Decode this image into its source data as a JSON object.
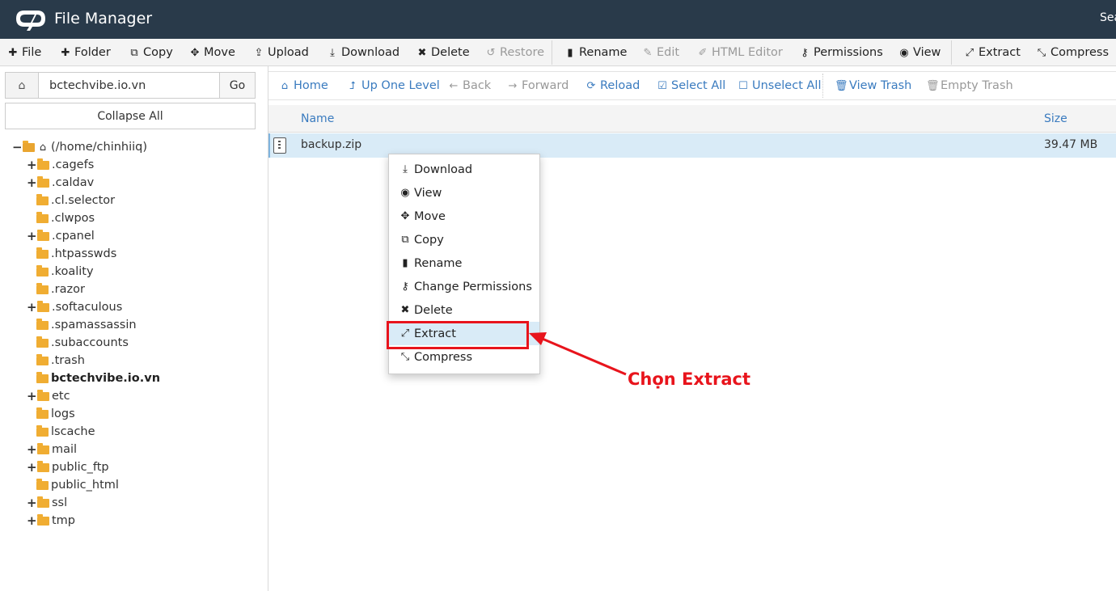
{
  "header": {
    "title": "File Manager",
    "search_partial": "Sea"
  },
  "toolbar": {
    "file": "File",
    "folder": "Folder",
    "copy": "Copy",
    "move": "Move",
    "upload": "Upload",
    "download": "Download",
    "delete": "Delete",
    "restore": "Restore",
    "rename": "Rename",
    "edit": "Edit",
    "html_editor": "HTML Editor",
    "permissions": "Permissions",
    "view": "View",
    "extract": "Extract",
    "compress": "Compress"
  },
  "sidebar": {
    "path_value": "bctechvibe.io.vn",
    "go_label": "Go",
    "collapse_label": "Collapse All",
    "root_label": "(/home/chinhiiq)",
    "items": [
      {
        "label": ".cagefs",
        "expandable": true
      },
      {
        "label": ".caldav",
        "expandable": true
      },
      {
        "label": ".cl.selector",
        "expandable": false
      },
      {
        "label": ".clwpos",
        "expandable": false
      },
      {
        "label": ".cpanel",
        "expandable": true
      },
      {
        "label": ".htpasswds",
        "expandable": false
      },
      {
        "label": ".koality",
        "expandable": false
      },
      {
        "label": ".razor",
        "expandable": false
      },
      {
        "label": ".softaculous",
        "expandable": true
      },
      {
        "label": ".spamassassin",
        "expandable": false
      },
      {
        "label": ".subaccounts",
        "expandable": false
      },
      {
        "label": ".trash",
        "expandable": false
      },
      {
        "label": "bctechvibe.io.vn",
        "expandable": false,
        "current": true
      },
      {
        "label": "etc",
        "expandable": true
      },
      {
        "label": "logs",
        "expandable": false
      },
      {
        "label": "lscache",
        "expandable": false
      },
      {
        "label": "mail",
        "expandable": true
      },
      {
        "label": "public_ftp",
        "expandable": true
      },
      {
        "label": "public_html",
        "expandable": false
      },
      {
        "label": "ssl",
        "expandable": true
      },
      {
        "label": "tmp",
        "expandable": true
      }
    ]
  },
  "navbar": {
    "home": "Home",
    "up_one_level": "Up One Level",
    "back": "Back",
    "forward": "Forward",
    "reload": "Reload",
    "select_all": "Select All",
    "unselect_all": "Unselect All",
    "view_trash": "View Trash",
    "empty_trash": "Empty Trash"
  },
  "table": {
    "col_name": "Name",
    "col_size": "Size",
    "rows": [
      {
        "name": "backup.zip",
        "size": "39.47 MB"
      }
    ]
  },
  "context_menu": {
    "download": "Download",
    "view": "View",
    "move": "Move",
    "copy": "Copy",
    "rename": "Rename",
    "change_permissions": "Change Permissions",
    "delete": "Delete",
    "extract": "Extract",
    "compress": "Compress"
  },
  "annotation": {
    "label": "Chọn Extract",
    "color": "#e8141c"
  },
  "colors": {
    "header_bg": "#293a4a",
    "link_blue": "#3a7bbf",
    "folder": "#f0ad32",
    "selection": "#d9ebf7"
  }
}
